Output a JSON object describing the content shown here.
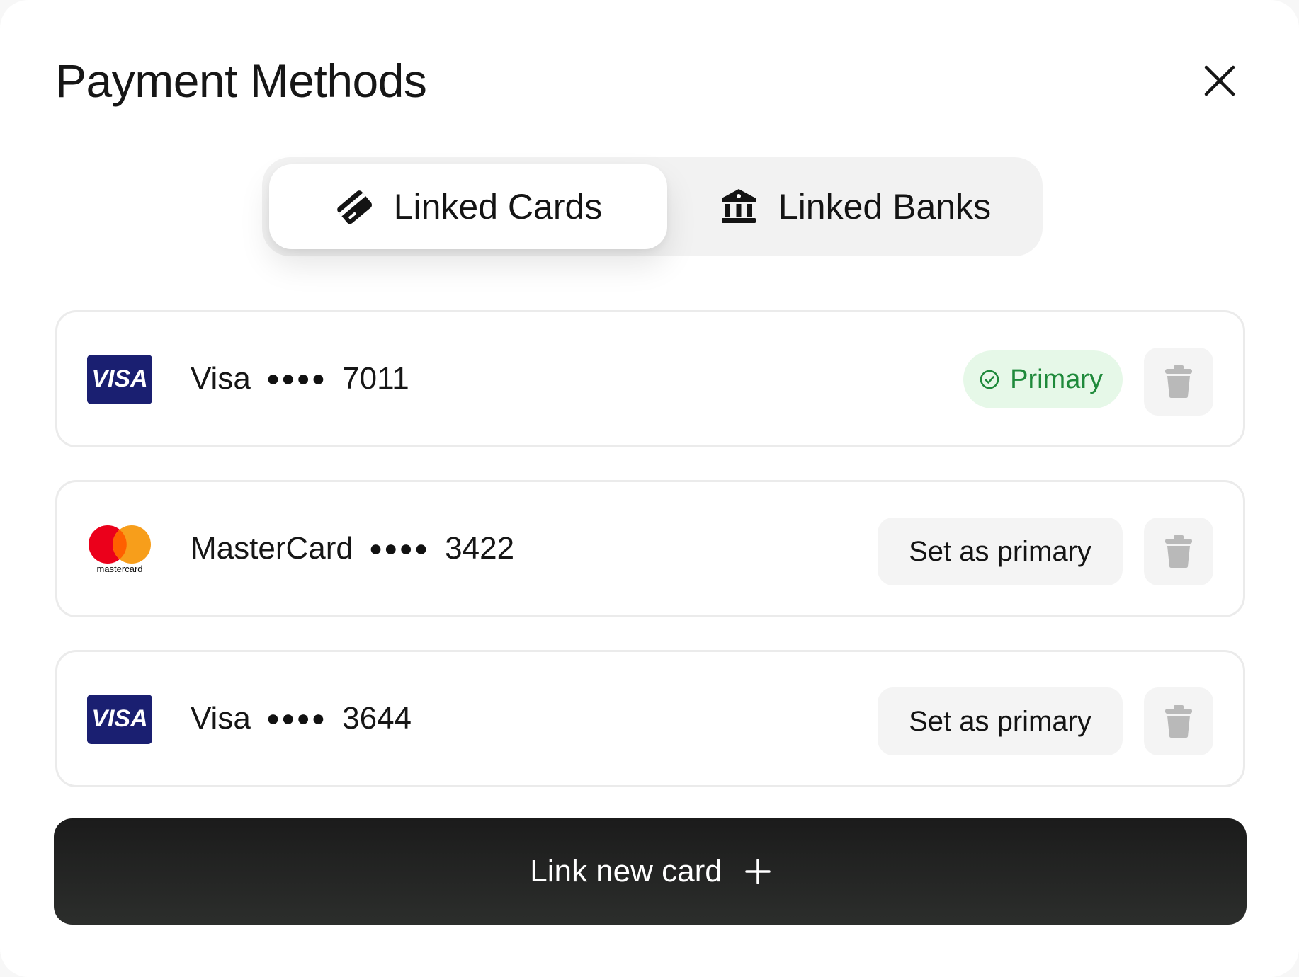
{
  "modal": {
    "title": "Payment Methods"
  },
  "tabs": [
    {
      "label": "Linked Cards",
      "icon": "card-icon",
      "active": true
    },
    {
      "label": "Linked Banks",
      "icon": "bank-icon",
      "active": false
    }
  ],
  "cards": [
    {
      "brand": "Visa",
      "logo": "visa-logo",
      "logo_text": "VISA",
      "masked": "●●●●",
      "last4": "7011",
      "primary": true
    },
    {
      "brand": "MasterCard",
      "logo": "mastercard-logo",
      "logo_text": "mastercard",
      "masked": "●●●●",
      "last4": "3422",
      "primary": false
    },
    {
      "brand": "Visa",
      "logo": "visa-logo",
      "logo_text": "VISA",
      "masked": "●●●●",
      "last4": "3644",
      "primary": false
    }
  ],
  "labels": {
    "primary_badge": "Primary",
    "set_primary": "Set as primary",
    "link_new_card": "Link new card"
  },
  "colors": {
    "primary_green": "#1f8a3b",
    "primary_badge_bg": "#e6f8e8",
    "visa_blue": "#1a1f71",
    "mastercard_red": "#eb001b",
    "mastercard_orange": "#f79e1b",
    "button_dark": "#1b1b1b"
  }
}
